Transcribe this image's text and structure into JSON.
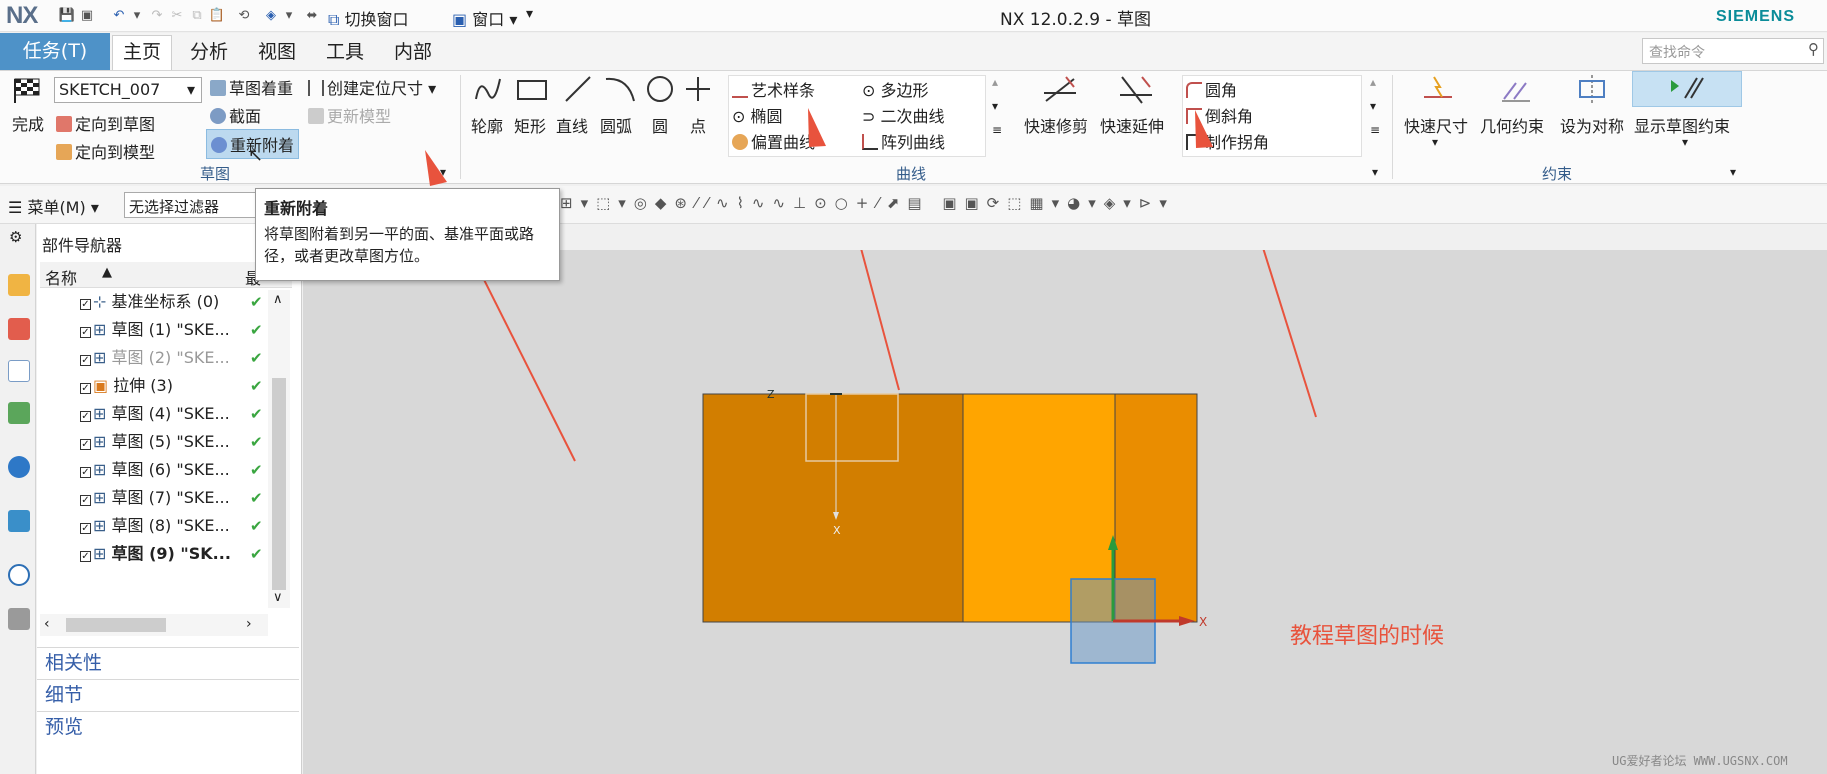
{
  "app": {
    "logo": "NX",
    "window_title": "NX 12.0.2.9 - 草图",
    "brand": "SIEMENS",
    "switch_window": "切换窗口",
    "window_menu": "窗口"
  },
  "tabs": [
    {
      "label": "任务(T)"
    },
    {
      "label": "主页"
    },
    {
      "label": "分析"
    },
    {
      "label": "视图"
    },
    {
      "label": "工具"
    },
    {
      "label": "内部"
    }
  ],
  "search_placeholder": "查找命令",
  "ribbon": {
    "sketch_group": {
      "finish": "完成",
      "sketch_name": "SKETCH_007",
      "orient_sketch": "定向到草图",
      "orient_model": "定向到模型",
      "sketch_color": "草图着重",
      "create_dim": "创建定位尺寸",
      "section": "截面",
      "update_model": "更新模型",
      "reattach": "重新附着",
      "label": "草图"
    },
    "curve_group": {
      "profile": "轮廓",
      "rectangle": "矩形",
      "line": "直线",
      "arc": "圆弧",
      "circle": "圆",
      "point": "点",
      "studio_spline": "艺术样条",
      "polygon": "多边形",
      "ellipse": "椭圆",
      "conic": "二次曲线",
      "offset_curve": "偏置曲线",
      "pattern_curve": "阵列曲线",
      "quick_trim": "快速修剪",
      "quick_extend": "快速延伸",
      "fillet": "圆角",
      "chamfer": "倒斜角",
      "make_corner": "制作拐角",
      "label": "曲线"
    },
    "constraint_group": {
      "rapid_dim": "快速尺寸",
      "geo_constraint": "几何约束",
      "make_symmetric": "设为对称",
      "show_constraints": "显示草图约束",
      "label": "约束"
    }
  },
  "toolbar": {
    "menu": "菜单(M)",
    "filter": "无选择过滤器"
  },
  "tooltip": {
    "title": "重新附着",
    "body": "将草图附着到另一平的面、基准平面或路径，或者更改草图方位。"
  },
  "navigator": {
    "title": "部件导航器",
    "col_name": "名称",
    "col_latest": "最",
    "rows": [
      {
        "label": "基准坐标系 (0)",
        "dim": false,
        "bold": false
      },
      {
        "label": "草图 (1) \"SKE...",
        "dim": false,
        "bold": false
      },
      {
        "label": "草图 (2) \"SKE...",
        "dim": true,
        "bold": false
      },
      {
        "label": "拉伸 (3)",
        "dim": false,
        "bold": false
      },
      {
        "label": "草图 (4) \"SKE...",
        "dim": false,
        "bold": false
      },
      {
        "label": "草图 (5) \"SKE...",
        "dim": false,
        "bold": false
      },
      {
        "label": "草图 (6) \"SKE...",
        "dim": false,
        "bold": false
      },
      {
        "label": "草图 (7) \"SKE...",
        "dim": false,
        "bold": false
      },
      {
        "label": "草图 (8) \"SKE...",
        "dim": false,
        "bold": false
      },
      {
        "label": "草图 (9) \"SK...",
        "dim": false,
        "bold": true
      }
    ],
    "sections": [
      "相关性",
      "细节",
      "预览"
    ]
  },
  "canvas": {
    "annotation": "教程草图的时候",
    "axis_x": "X",
    "axis_z": "Z",
    "colors": {
      "dark_face": "#d27e00",
      "light_face": "#ffa500",
      "mid_face": "#ea8d00",
      "arrow": "#e8533d"
    }
  },
  "watermark": "UG爱好者论坛 WWW.UGSNX.COM"
}
